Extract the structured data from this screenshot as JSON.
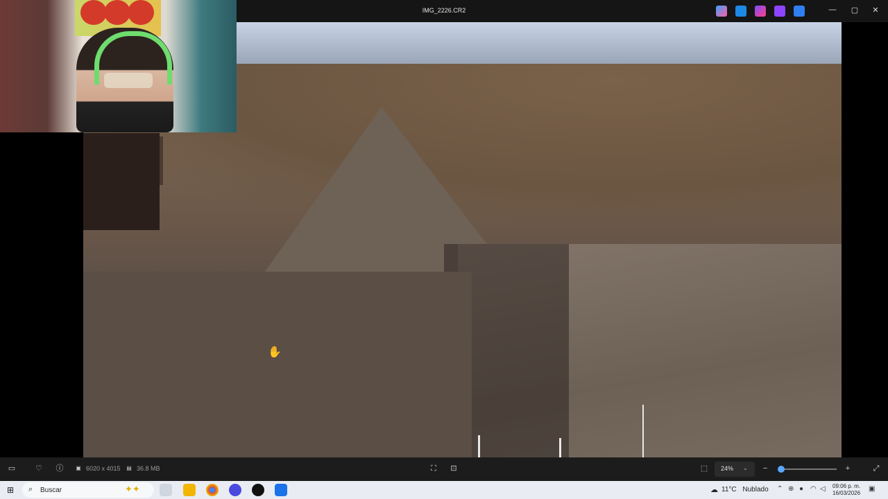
{
  "window": {
    "title": "IMG_2226.CR2"
  },
  "top_icons": [
    "copilot-icon",
    "editor-icon",
    "designer-icon",
    "clipchamp-icon",
    "onedrive-icon"
  ],
  "window_controls": {
    "minimize": "—",
    "maximize": "▢",
    "close": "✕"
  },
  "info_bar": {
    "dimensions": "6020 x 4015",
    "file_size": "36.8 MB",
    "zoom": "24%",
    "zoom_slider_fraction": 0.05
  },
  "taskbar": {
    "search_label": "Buscar",
    "weather_temp": "11°C",
    "weather_text": "Nublado",
    "time": "09:06 p. m.",
    "date": "16/03/2026"
  },
  "colors": {
    "accent": "#5aa7ff",
    "toolbar_bg": "#1c1c1c",
    "titlebar_bg": "#151515"
  }
}
